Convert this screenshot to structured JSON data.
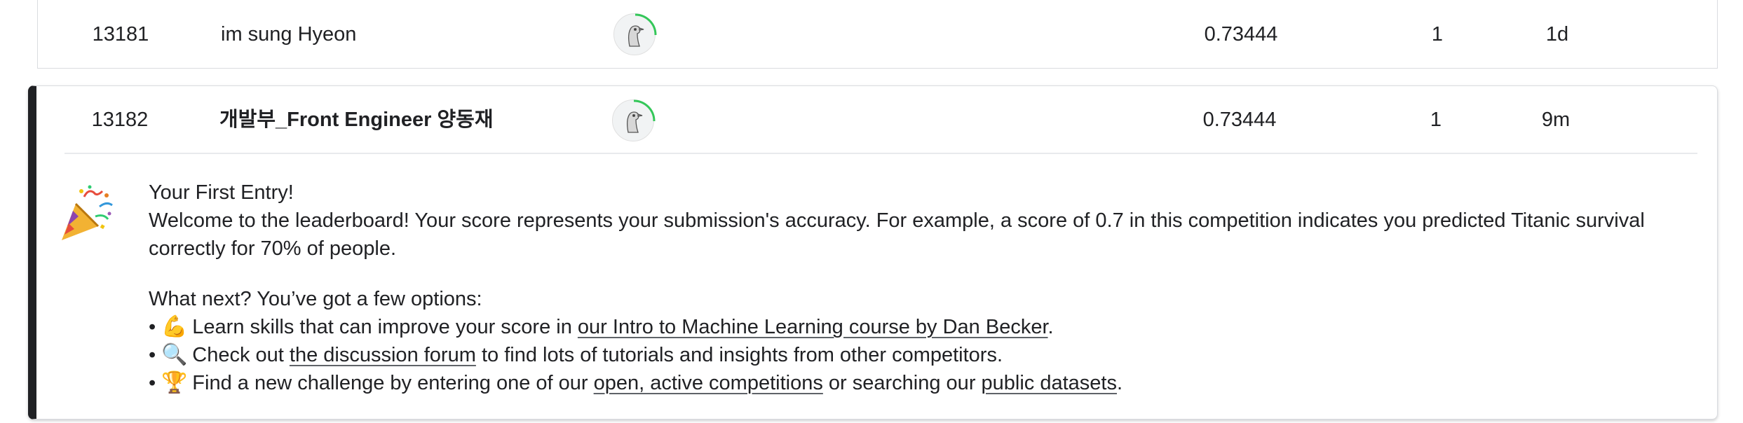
{
  "leaderboard": {
    "rows": [
      {
        "rank": "13181",
        "team_name": "im sung Hyeon",
        "score": "0.73444",
        "entries": "1",
        "last": "1d"
      },
      {
        "rank": "13182",
        "team_name": "개발부_Front Engineer 양동재",
        "score": "0.73444",
        "entries": "1",
        "last": "9m"
      }
    ],
    "avatar_icon": "ostrich-avatar-icon",
    "accent_color": "#20beff",
    "progress_ring_color": "#34c759",
    "progress_ring_fraction": 0.25,
    "highlight_border_color": "#202124"
  },
  "first_entry": {
    "title": "Your First Entry!",
    "welcome": "Welcome to the leaderboard! Your score represents your submission's accuracy. For example, a score of 0.7 in this competition indicates you predicted Titanic survival correctly for 70% of people.",
    "next_intro": "What next? You’ve got a few options:",
    "bullet_char": "•",
    "options": [
      {
        "emoji": "💪",
        "emoji_name": "flexed-biceps-icon",
        "before": "Learn skills that can improve your score in ",
        "link1": "our Intro to Machine Learning course by Dan Becker",
        "middle": ".",
        "link2": "",
        "after": ""
      },
      {
        "emoji": "🔍",
        "emoji_name": "magnifier-icon",
        "before": "Check out ",
        "link1": "the discussion forum",
        "middle": " to find lots of tutorials and insights from other competitors.",
        "link2": "",
        "after": ""
      },
      {
        "emoji": "🏆",
        "emoji_name": "trophy-icon",
        "before": "Find a new challenge by entering one of our ",
        "link1": "open, active competitions",
        "middle": " or searching our ",
        "link2": "public datasets",
        "after": "."
      }
    ],
    "celebration_icon": "party-popper-icon"
  }
}
